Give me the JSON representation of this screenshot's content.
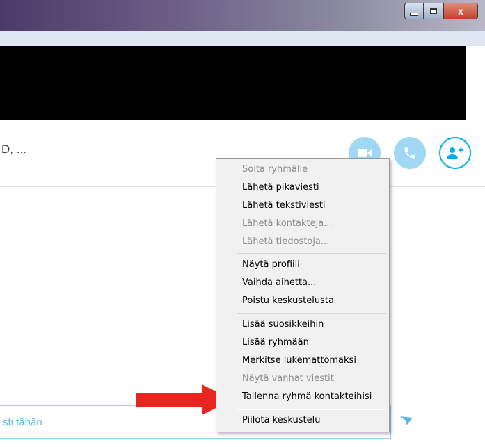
{
  "window": {
    "minimize_icon": "minimize-icon",
    "maximize_icon": "maximize-icon",
    "close_label": "x"
  },
  "conversation": {
    "participants_text": "D, ...",
    "call_buttons": {
      "video_icon": "video-camera-icon",
      "call_icon": "phone-icon",
      "add_icon": "add-person-icon"
    }
  },
  "message_input": {
    "placeholder_fragment": "sti tähän",
    "send_icon": "send-icon"
  },
  "context_menu": {
    "groups": [
      [
        {
          "label": "Soita ryhmälle",
          "enabled": false
        },
        {
          "label": "Lähetä pikaviesti",
          "enabled": true
        },
        {
          "label": "Lähetä tekstiviesti",
          "enabled": true
        },
        {
          "label": "Lähetä kontakteja...",
          "enabled": false
        },
        {
          "label": "Lähetä tiedostoja...",
          "enabled": false
        }
      ],
      [
        {
          "label": "Näytä profiili",
          "enabled": true
        },
        {
          "label": "Vaihda aihetta...",
          "enabled": true
        },
        {
          "label": "Poistu keskustelusta",
          "enabled": true
        }
      ],
      [
        {
          "label": "Lisää suosikkeihin",
          "enabled": true
        },
        {
          "label": "Lisää ryhmään",
          "enabled": true
        },
        {
          "label": "Merkitse lukemattomaksi",
          "enabled": true
        },
        {
          "label": "Näytä vanhat viestit",
          "enabled": false
        },
        {
          "label": "Tallenna ryhmä kontakteihisi",
          "enabled": true
        }
      ],
      [
        {
          "label": "Piilota keskustelu",
          "enabled": true
        }
      ]
    ]
  },
  "annotation": {
    "arrow_color": "#e8261f",
    "arrow_icon": "red-arrow-icon"
  },
  "colors": {
    "accent": "#00aff0",
    "accent_light": "#9fd8f2"
  }
}
